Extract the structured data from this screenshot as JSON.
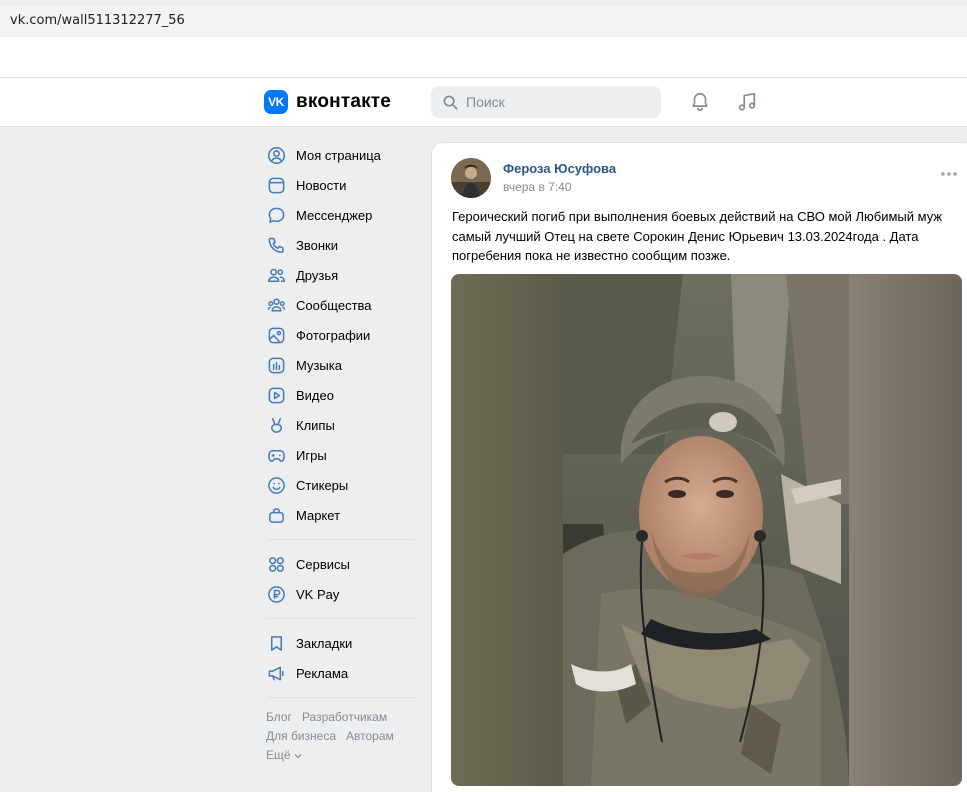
{
  "browser": {
    "url": "vk.com/wall511312277_56"
  },
  "header": {
    "logo_mark": "VK",
    "logo_text": "вконтакте",
    "search_placeholder": "Поиск"
  },
  "sidebar": {
    "items": [
      {
        "label": "Моя страница",
        "icon": "user-circle-icon"
      },
      {
        "label": "Новости",
        "icon": "news-icon"
      },
      {
        "label": "Мессенджер",
        "icon": "message-icon"
      },
      {
        "label": "Звонки",
        "icon": "phone-icon"
      },
      {
        "label": "Друзья",
        "icon": "friends-icon"
      },
      {
        "label": "Сообщества",
        "icon": "communities-icon"
      },
      {
        "label": "Фотографии",
        "icon": "photo-icon"
      },
      {
        "label": "Музыка",
        "icon": "music-icon"
      },
      {
        "label": "Видео",
        "icon": "video-icon"
      },
      {
        "label": "Клипы",
        "icon": "clips-icon"
      },
      {
        "label": "Игры",
        "icon": "gamepad-icon"
      },
      {
        "label": "Стикеры",
        "icon": "smile-icon"
      },
      {
        "label": "Маркет",
        "icon": "bag-icon"
      }
    ],
    "items2": [
      {
        "label": "Сервисы",
        "icon": "services-icon"
      },
      {
        "label": "VK Pay",
        "icon": "ruble-icon"
      }
    ],
    "items3": [
      {
        "label": "Закладки",
        "icon": "bookmark-icon"
      },
      {
        "label": "Реклама",
        "icon": "megaphone-icon"
      }
    ],
    "footer": {
      "blog": "Блог",
      "developers": "Разработчикам",
      "business": "Для бизнеса",
      "authors": "Авторам",
      "more": "Ещё"
    }
  },
  "post": {
    "author": "Фероза Юсуфова",
    "time": "вчера в 7:40",
    "text": "Героический погиб при выполнения боевых действий на СВО мой Любимый муж самый лучший Отец на свете Сорокин Денис Юрьевич 13.03.2024года . Дата погребения пока не известно сообщим позже."
  },
  "colors": {
    "accent": "#0077ff",
    "link": "#2a5885",
    "icon": "#447bba",
    "muted": "#818c99"
  }
}
